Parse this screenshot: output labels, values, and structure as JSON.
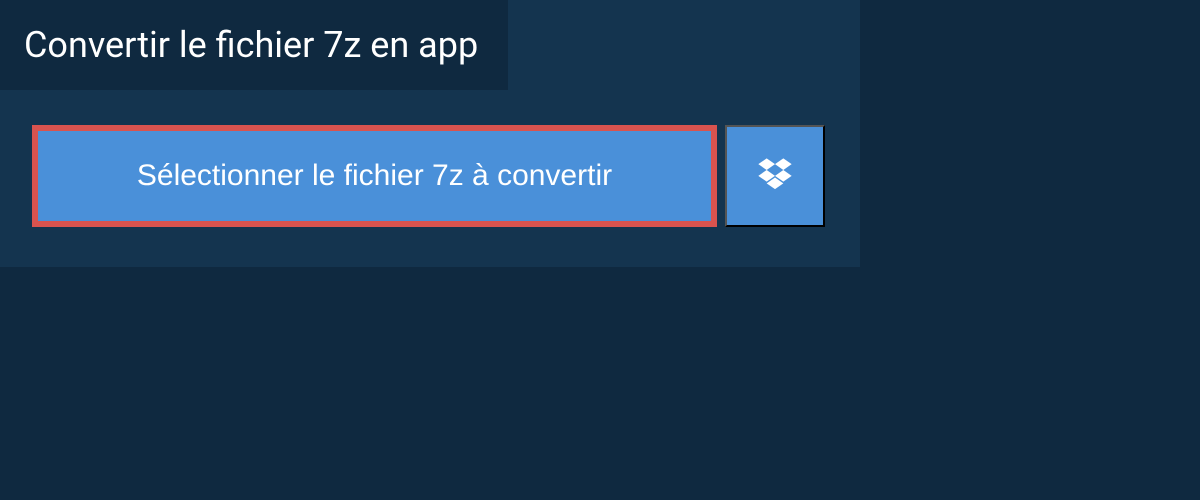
{
  "header": {
    "title": "Convertir le fichier 7z en app"
  },
  "actions": {
    "select_file_label": "Sélectionner le fichier 7z à convertir"
  }
}
